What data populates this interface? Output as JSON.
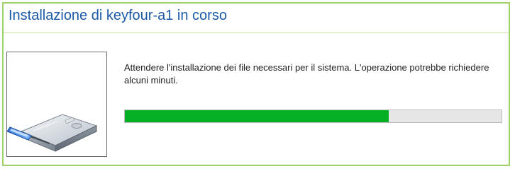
{
  "window": {
    "title": "Installazione di keyfour-a1 in corso",
    "accent_border": "#9fcf6a",
    "title_color": "#1c5aa8"
  },
  "content": {
    "illustration_icon": "disk-drive-install-icon",
    "message": "Attendere l'installazione dei file necessari per il sistema. L'operazione potrebbe richiedere alcuni minuti.",
    "progress": {
      "fraction": 0.7,
      "fill_color": "#06b025",
      "track_color": "#e6e6e6"
    }
  }
}
